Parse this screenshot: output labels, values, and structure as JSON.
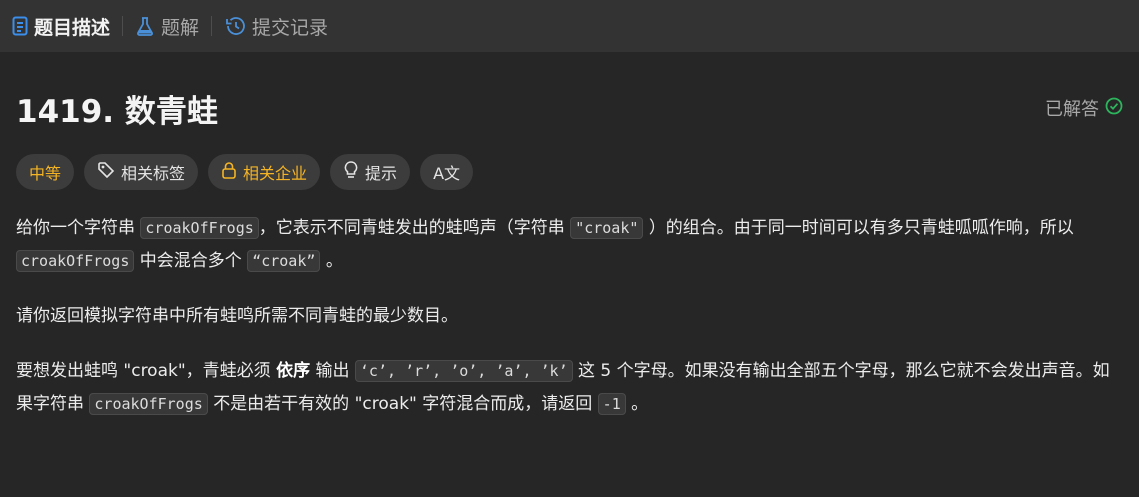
{
  "tabs": [
    {
      "label": "题目描述",
      "icon": "description-icon"
    },
    {
      "label": "题解",
      "icon": "flask-icon"
    },
    {
      "label": "提交记录",
      "icon": "history-icon"
    }
  ],
  "problem": {
    "title": "1419. 数青蛙",
    "status": "已解答",
    "colors": {
      "accent": "#f5b423",
      "solved": "#2db55d"
    }
  },
  "tags": {
    "difficulty": "中等",
    "related_tags": "相关标签",
    "related_companies": "相关企业",
    "hint": "提示",
    "translate": "A文"
  },
  "desc": {
    "p1_a": "给你一个字符串",
    "p1_code1": "croakOfFrogs",
    "p1_b": "，它表示不同青蛙发出的蛙鸣声（字符串",
    "p1_code2": "\"croak\"",
    "p1_c": "）的组合。由于同一时间可以有多只青蛙呱呱作响，所以",
    "p1_code3": "croakOfFrogs",
    "p1_d": "中会混合多个",
    "p1_code4": "“croak”",
    "p1_e": "。",
    "p2": "请你返回模拟字符串中所有蛙鸣所需不同青蛙的最少数目。",
    "p3_a": "要想发出蛙鸣 \"croak\"，青蛙必须",
    "p3_bold": "依序",
    "p3_b": "输出",
    "p3_code1": "‘c’, ’r’, ’o’, ’a’, ’k’",
    "p3_c": "这 5 个字母。如果没有输出全部五个字母，那么它就不会发出声音。如果字符串",
    "p3_code2": "croakOfFrogs",
    "p3_d": "不是由若干有效的 \"croak\" 字符混合而成，请返回",
    "p3_code3": "-1",
    "p3_e": "。"
  }
}
